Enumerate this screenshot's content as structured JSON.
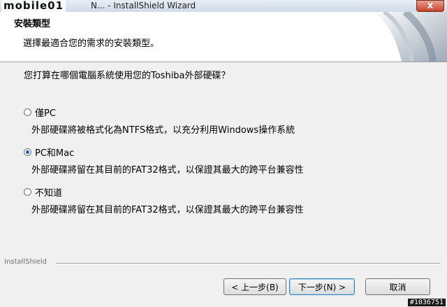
{
  "window": {
    "logo": "mobile01",
    "title": "N... - InstallShield Wizard",
    "close": "X"
  },
  "header": {
    "title": "安裝類型",
    "subtitle": "選擇最適合您的需求的安裝類型。"
  },
  "main": {
    "question": "您打算在哪個電腦系統使用您的Toshiba外部硬碟？",
    "options": [
      {
        "label": "僅PC",
        "description": "外部硬碟將被格式化為NTFS格式，以充分利用Windows操作系統",
        "selected": false
      },
      {
        "label": "PC和Mac",
        "description": "外部硬碟將留在其目前的FAT32格式，以保證其最大的跨平台兼容性",
        "selected": true
      },
      {
        "label": "不知道",
        "description": "外部硬碟將留在其目前的FAT32格式，以保證其最大的跨平台兼容性",
        "selected": false
      }
    ]
  },
  "footer": {
    "brand": "InstallShield",
    "back_label": "< 上一步(B)",
    "next_label": "下一步(N) >",
    "cancel_label": "取消"
  },
  "watermark": "#1036751"
}
